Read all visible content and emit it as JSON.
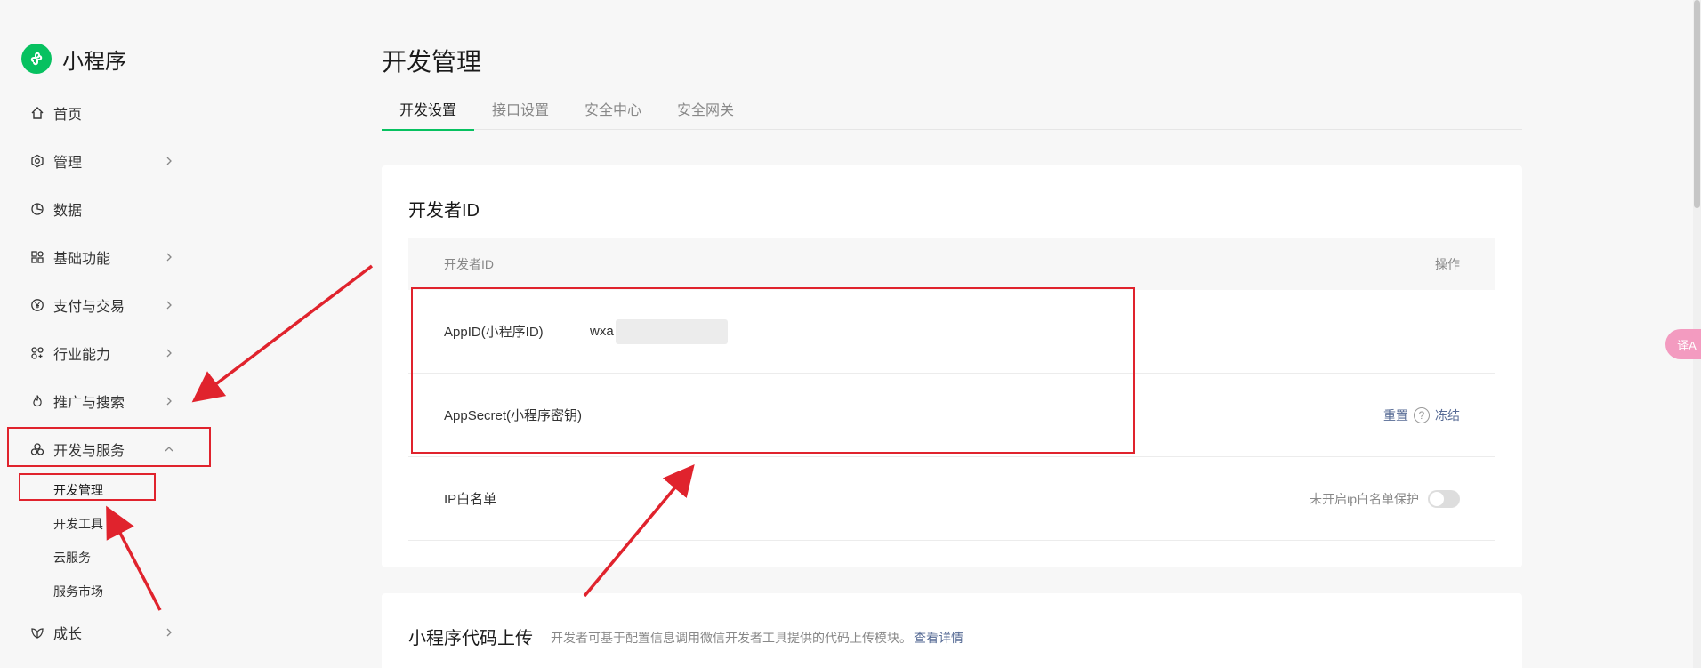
{
  "app": {
    "name": "小程序"
  },
  "sidebar": {
    "items": [
      {
        "label": "首页",
        "icon": "home-icon"
      },
      {
        "label": "管理",
        "icon": "manage-icon"
      },
      {
        "label": "数据",
        "icon": "chart-icon"
      },
      {
        "label": "基础功能",
        "icon": "grid-icon"
      },
      {
        "label": "支付与交易",
        "icon": "yen-icon"
      },
      {
        "label": "行业能力",
        "icon": "industry-icon"
      },
      {
        "label": "推广与搜索",
        "icon": "flame-icon"
      },
      {
        "label": "开发与服务",
        "icon": "dev-icon"
      }
    ],
    "subitems": [
      {
        "label": "开发管理"
      },
      {
        "label": "开发工具"
      },
      {
        "label": "云服务"
      },
      {
        "label": "服务市场"
      }
    ],
    "bottom": {
      "label": "成长",
      "icon": "growth-icon"
    }
  },
  "main": {
    "title": "开发管理",
    "tabs": [
      {
        "label": "开发设置"
      },
      {
        "label": "接口设置"
      },
      {
        "label": "安全中心"
      },
      {
        "label": "安全网关"
      }
    ],
    "card": {
      "title": "开发者ID",
      "table": {
        "col1": "开发者ID",
        "col2": "操作",
        "rows": [
          {
            "label": "AppID(小程序ID)",
            "value": "wxa"
          },
          {
            "label": "AppSecret(小程序密钥)",
            "reset": "重置",
            "help": "?",
            "freeze": "冻结"
          },
          {
            "label": "IP白名单",
            "status": "未开启ip白名单保护"
          }
        ]
      }
    },
    "card2": {
      "title": "小程序代码上传",
      "desc": "开发者可基于配置信息调用微信开发者工具提供的代码上传模块。",
      "link": "查看详情"
    }
  },
  "floating": {
    "label": "译A"
  },
  "colors": {
    "brand": "#07c160",
    "annotation": "#e0232d",
    "link": "#576b95"
  }
}
